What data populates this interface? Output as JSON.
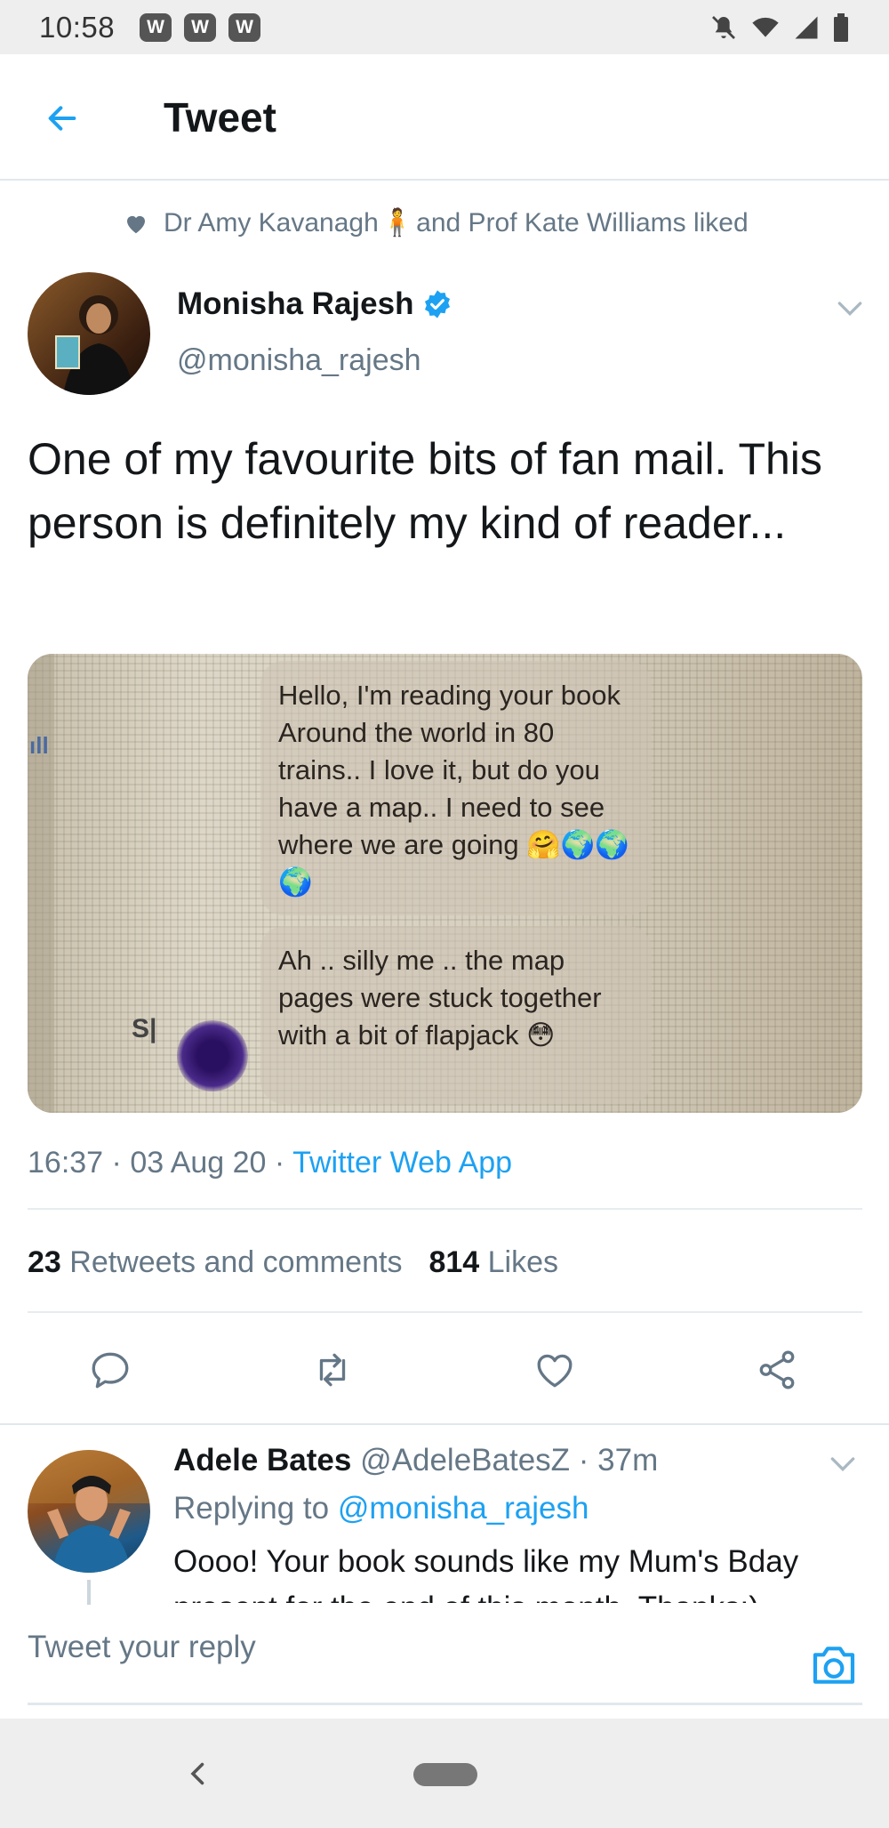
{
  "status_bar": {
    "time": "10:58",
    "notifications": [
      "W",
      "W",
      "W"
    ]
  },
  "app_bar": {
    "title": "Tweet"
  },
  "social_context": {
    "text_before": "Dr Amy Kavanagh",
    "text_after": "and Prof Kate Williams liked"
  },
  "author": {
    "name": "Monisha Rajesh",
    "handle": "@monisha_rajesh"
  },
  "tweet": {
    "text": "One of my favourite bits of fan mail. This person is definitely my kind of reader...",
    "media": {
      "bubble1": "Hello, I'm reading your book Around the world in 80 trains.. I love it, but do you have a map.. I need to  see where we are going 🤗🌍🌍🌍",
      "bubble2": "Ah .. silly me .. the map pages were stuck together with a bit of flapjack 😳",
      "signal": "ıll",
      "sp": "S|"
    },
    "time": "16:37",
    "date": "03 Aug 20",
    "source": "Twitter Web App",
    "retweets_count": "23",
    "retweets_label": "Retweets and comments",
    "likes_count": "814",
    "likes_label": "Likes"
  },
  "reply": {
    "name": "Adele Bates",
    "handle": "@AdeleBatesZ",
    "age": "37m",
    "replying_label": "Replying to",
    "replying_mention": "@monisha_rajesh",
    "text": "Oooo! Your book sounds like my Mum's Bday present for the end of this month. Thanks:)"
  },
  "compose": {
    "placeholder": "Tweet your reply"
  },
  "colors": {
    "accent": "#1da1f2",
    "secondary_text": "#657786",
    "primary_text": "#14171a"
  }
}
